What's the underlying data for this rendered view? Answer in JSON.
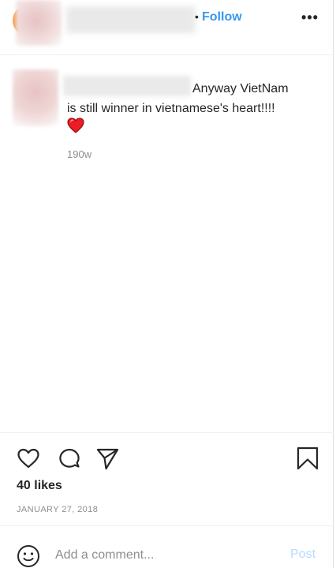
{
  "header": {
    "separator": "•",
    "follow_label": "Follow",
    "more_label": "•••"
  },
  "caption": {
    "text_line1": "Anyway VietNam",
    "text_line2": "is still winner in vietnamese's heart!!!!",
    "emoji": "red-heart",
    "time_ago": "190w"
  },
  "actions": {
    "likes": "40 likes",
    "date": "JANUARY 27, 2018"
  },
  "comment": {
    "placeholder": "Add a comment...",
    "post_label": "Post"
  },
  "colors": {
    "link_blue": "#3897f0",
    "post_disabled": "#b3dbff",
    "heart_red": "#ed1c24",
    "story_ring": "#f6a04d"
  },
  "icons": {
    "like": "heart-outline-icon",
    "comment": "comment-bubble-icon",
    "share": "paper-plane-icon",
    "save": "bookmark-icon",
    "emoji": "smiley-icon"
  }
}
